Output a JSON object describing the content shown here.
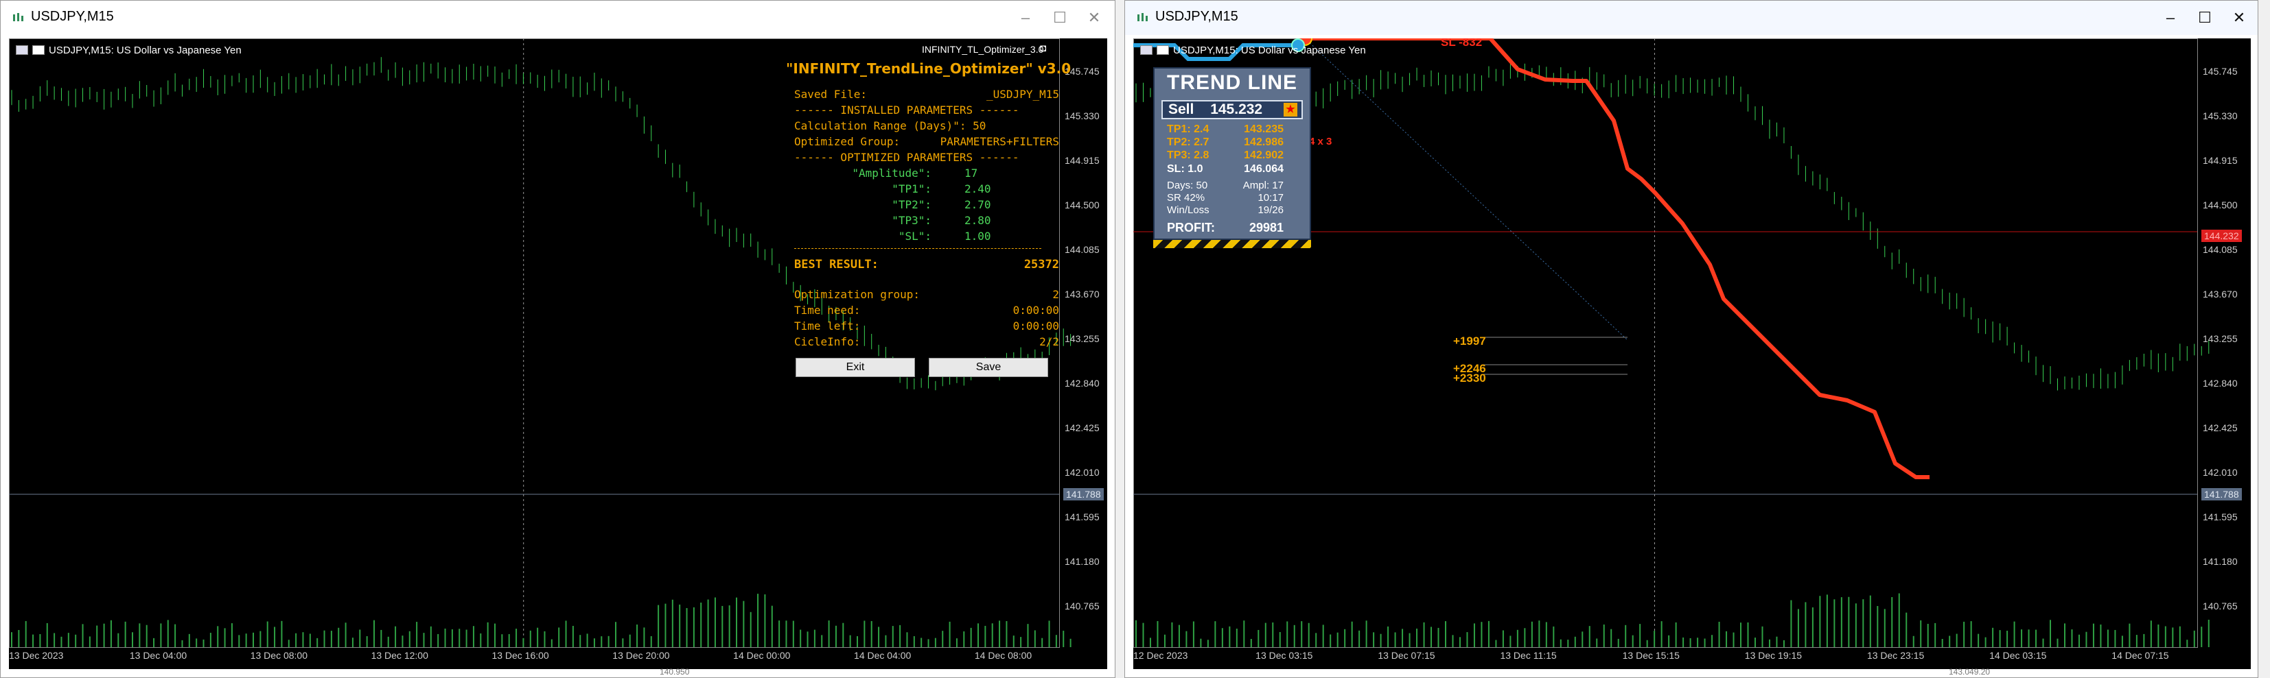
{
  "left_window": {
    "title": "USDJPY,M15",
    "header": "USDJPY,M15:  US Dollar vs Japanese Yen",
    "indicator_name": "INFINITY_TL_Optimizer_3.0",
    "current_price": "141.788",
    "price_axis": [
      "145.745",
      "145.330",
      "144.915",
      "144.500",
      "144.085",
      "143.670",
      "143.255",
      "142.840",
      "142.425",
      "142.010",
      "141.595",
      "141.180",
      "140.765"
    ],
    "time_axis": [
      "13 Dec 2023",
      "13 Dec 04:00",
      "13 Dec 08:00",
      "13 Dec 12:00",
      "13 Dec 16:00",
      "13 Dec 20:00",
      "14 Dec 00:00",
      "14 Dec 04:00",
      "14 Dec 08:00"
    ],
    "below_label": "140.950"
  },
  "optimizer": {
    "title": "\"INFINITY_TrendLine_Optimizer\" v3.0",
    "saved_file_label": "Saved File:",
    "saved_file_value": "_USDJPY_M15",
    "installed_header": "------ INSTALLED PARAMETERS ------",
    "calc_range": "Calculation Range (Days)\": 50",
    "opt_group_label": "Optimized Group:",
    "opt_group_value": "PARAMETERS+FILTERS",
    "optimized_header": "------ OPTIMIZED PARAMETERS ------",
    "params": [
      {
        "name": "\"Amplitude\":",
        "value": "17"
      },
      {
        "name": "\"TP1\":",
        "value": "2.40"
      },
      {
        "name": "\"TP2\":",
        "value": "2.70"
      },
      {
        "name": "\"TP3\":",
        "value": "2.80"
      },
      {
        "name": "\"SL\":",
        "value": "1.00"
      }
    ],
    "best_label": "BEST RESULT:",
    "best_value": "25372",
    "group_label": "Optimization group:",
    "group_value": "2",
    "time_need_label": "Time need:",
    "time_need_value": "0:00:00",
    "time_left_label": "Time left:",
    "time_left_value": "0:00:00",
    "cicle_label": "CicleInfo:",
    "cicle_value": "2/2",
    "exit_label": "Exit",
    "save_label": "Save"
  },
  "right_window": {
    "title": "USDJPY,M15",
    "header": "USDJPY,M15:  US Dollar vs Japanese Yen",
    "current_price": "141.788",
    "level_price": "144.232",
    "price_axis": [
      "145.745",
      "145.330",
      "144.915",
      "144.500",
      "144.085",
      "143.670",
      "143.255",
      "142.840",
      "142.425",
      "142.010",
      "141.595",
      "141.180",
      "140.765"
    ],
    "time_axis": [
      "12 Dec 2023",
      "13 Dec 03:15",
      "13 Dec 07:15",
      "13 Dec 11:15",
      "13 Dec 15:15",
      "13 Dec 19:15",
      "13 Dec 23:15",
      "14 Dec 03:15",
      "14 Dec 07:15"
    ],
    "below_label": "143.049.20",
    "signal_label": "SL -832",
    "multiplier_label": "4 x 3",
    "profit_labels": [
      "+1997",
      "+2246",
      "+2330"
    ]
  },
  "trend_line": {
    "title": "TREND LINE",
    "sell_label": "Sell",
    "sell_price": "145.232",
    "rows": [
      {
        "label": "TP1: 2.4",
        "value": "143.235",
        "color": "#f0a500"
      },
      {
        "label": "TP2: 2.7",
        "value": "142.986",
        "color": "#f0a500"
      },
      {
        "label": "TP3: 2.8",
        "value": "142.902",
        "color": "#f0a500"
      },
      {
        "label": "SL: 1.0",
        "value": "146.064",
        "color": "#ffffff"
      }
    ],
    "days_label": "Days: 50",
    "ampl_label": "Ampl: 17",
    "sr_label": "SR  42%",
    "sr_value": "10:17",
    "winloss_label": "Win/Loss",
    "winloss_value": "19/26",
    "profit_label": "PROFIT:",
    "profit_value": "29981"
  },
  "colors": {
    "candle": "#39d353",
    "volume": "#2ea043",
    "orange_accent": "#f0a500",
    "stop_line": "#ff3b1f",
    "entry_line": "#2aa3e0",
    "level_tag": "#e02020",
    "price_tag": "#5a6b84"
  }
}
